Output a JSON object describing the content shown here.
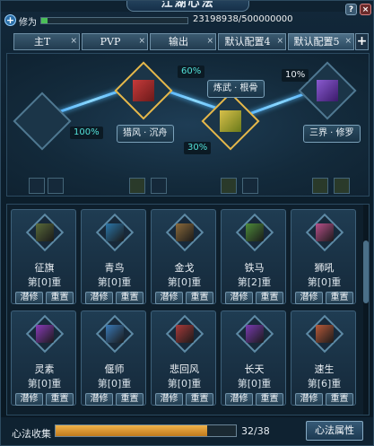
{
  "window": {
    "title": "江湖心法",
    "help": "?",
    "close": "×"
  },
  "cultivation": {
    "label": "修为",
    "current": 23198938,
    "max": 500000000,
    "text": "23198938/500000000",
    "fraction": 0.046
  },
  "tabs": [
    {
      "label": "主T",
      "close": "×"
    },
    {
      "label": "PVP",
      "close": "×"
    },
    {
      "label": "输出",
      "close": "×"
    },
    {
      "label": "默认配置4",
      "close": "×"
    },
    {
      "label": "默认配置5",
      "close": "×"
    }
  ],
  "tab_add": "+",
  "tree": {
    "percents": {
      "p60": "60%",
      "p100": "100%",
      "p30": "30%",
      "p10": "10%"
    },
    "labels": {
      "liefeng": "猎风 · 沉舟",
      "lianwu": "炼武 · 根骨",
      "sanjie": "三界 · 修罗"
    }
  },
  "cards": [
    {
      "name": "征旗",
      "level": "第[0]重",
      "color": "#5a6b3a"
    },
    {
      "name": "青鸟",
      "level": "第[0]重",
      "color": "#2b76a8"
    },
    {
      "name": "金戈",
      "level": "第[0]重",
      "color": "#8a6a3b"
    },
    {
      "name": "铁马",
      "level": "第[2]重",
      "color": "#4e8b3a"
    },
    {
      "name": "狮吼",
      "level": "第[0]重",
      "color": "#b8508a"
    },
    {
      "name": "灵素",
      "level": "第[0]重",
      "color": "#8a3bb8"
    },
    {
      "name": "偃师",
      "level": "第[0]重",
      "color": "#3a7ab8"
    },
    {
      "name": "悲回风",
      "level": "第[0]重",
      "color": "#a83a3a"
    },
    {
      "name": "长天",
      "level": "第[0]重",
      "color": "#7a3bb0"
    },
    {
      "name": "速生",
      "level": "第[6]重",
      "color": "#b85a3a"
    }
  ],
  "card_buttons": {
    "study": "潜修",
    "reset": "重置"
  },
  "footer": {
    "label": "心法收集",
    "text": "32/38",
    "fraction": 0.842,
    "attr_button": "心法属性"
  }
}
